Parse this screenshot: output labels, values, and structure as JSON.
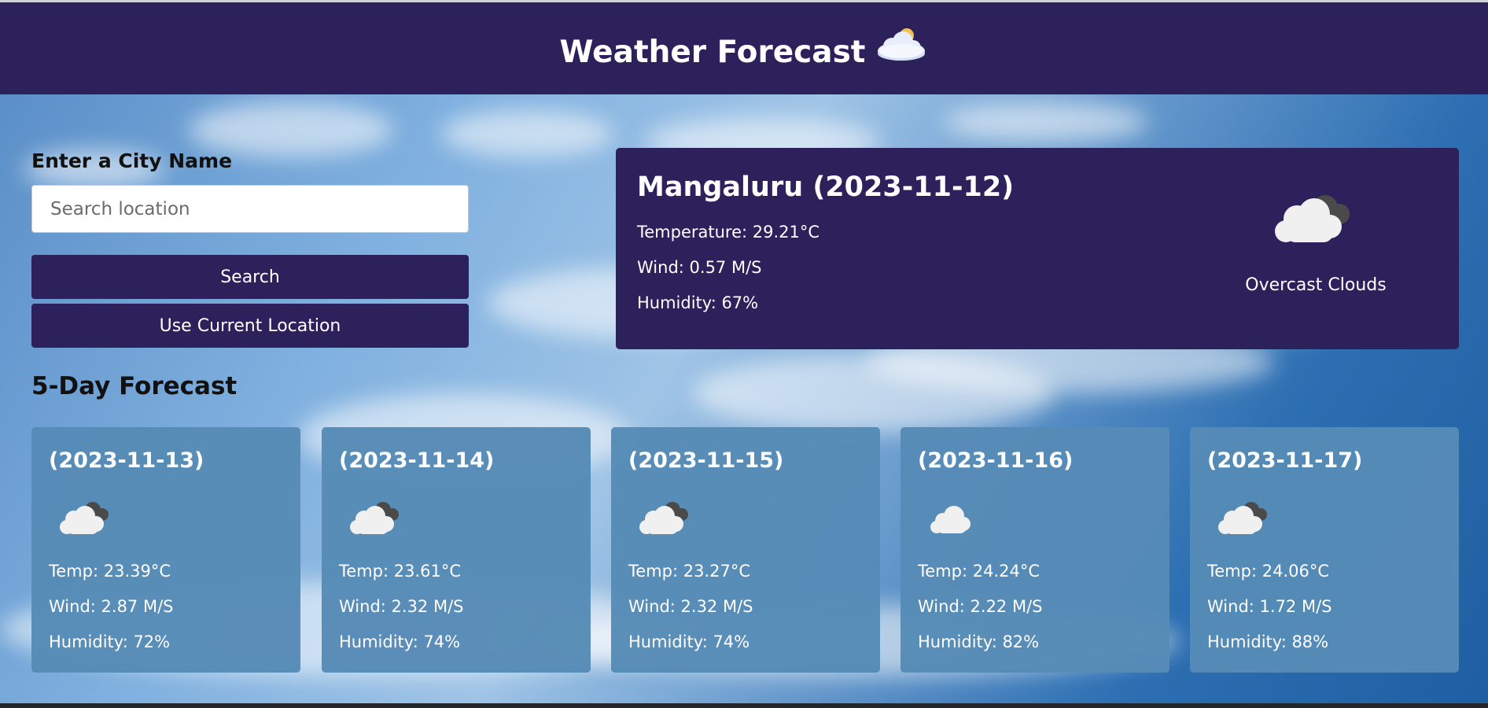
{
  "header": {
    "title": "Weather Forecast",
    "icon": "cloud-sun-icon"
  },
  "search": {
    "label": "Enter a City Name",
    "placeholder": "Search location",
    "value": "",
    "search_button": "Search",
    "location_button": "Use Current Location"
  },
  "current": {
    "title": "Mangaluru (2023-11-12)",
    "temperature": "Temperature: 29.21°C",
    "wind": "Wind: 0.57 M/S",
    "humidity": "Humidity: 67%",
    "description": "Overcast Clouds",
    "icon": "overcast-clouds-icon"
  },
  "forecast": {
    "heading": "5-Day Forecast",
    "days": [
      {
        "date": "(2023-11-13)",
        "temp": "Temp: 23.39°C",
        "wind": "Wind: 2.87 M/S",
        "humidity": "Humidity: 72%",
        "icon": "overcast-clouds-icon"
      },
      {
        "date": "(2023-11-14)",
        "temp": "Temp: 23.61°C",
        "wind": "Wind: 2.32 M/S",
        "humidity": "Humidity: 74%",
        "icon": "overcast-clouds-icon"
      },
      {
        "date": "(2023-11-15)",
        "temp": "Temp: 23.27°C",
        "wind": "Wind: 2.32 M/S",
        "humidity": "Humidity: 74%",
        "icon": "overcast-clouds-icon"
      },
      {
        "date": "(2023-11-16)",
        "temp": "Temp: 24.24°C",
        "wind": "Wind: 2.22 M/S",
        "humidity": "Humidity: 82%",
        "icon": "cloud-icon"
      },
      {
        "date": "(2023-11-17)",
        "temp": "Temp: 24.06°C",
        "wind": "Wind: 1.72 M/S",
        "humidity": "Humidity: 88%",
        "icon": "overcast-clouds-icon"
      }
    ]
  },
  "colors": {
    "primary": "#2d215c",
    "forecast_card": "#568bb6",
    "text_light": "#ffffff"
  }
}
